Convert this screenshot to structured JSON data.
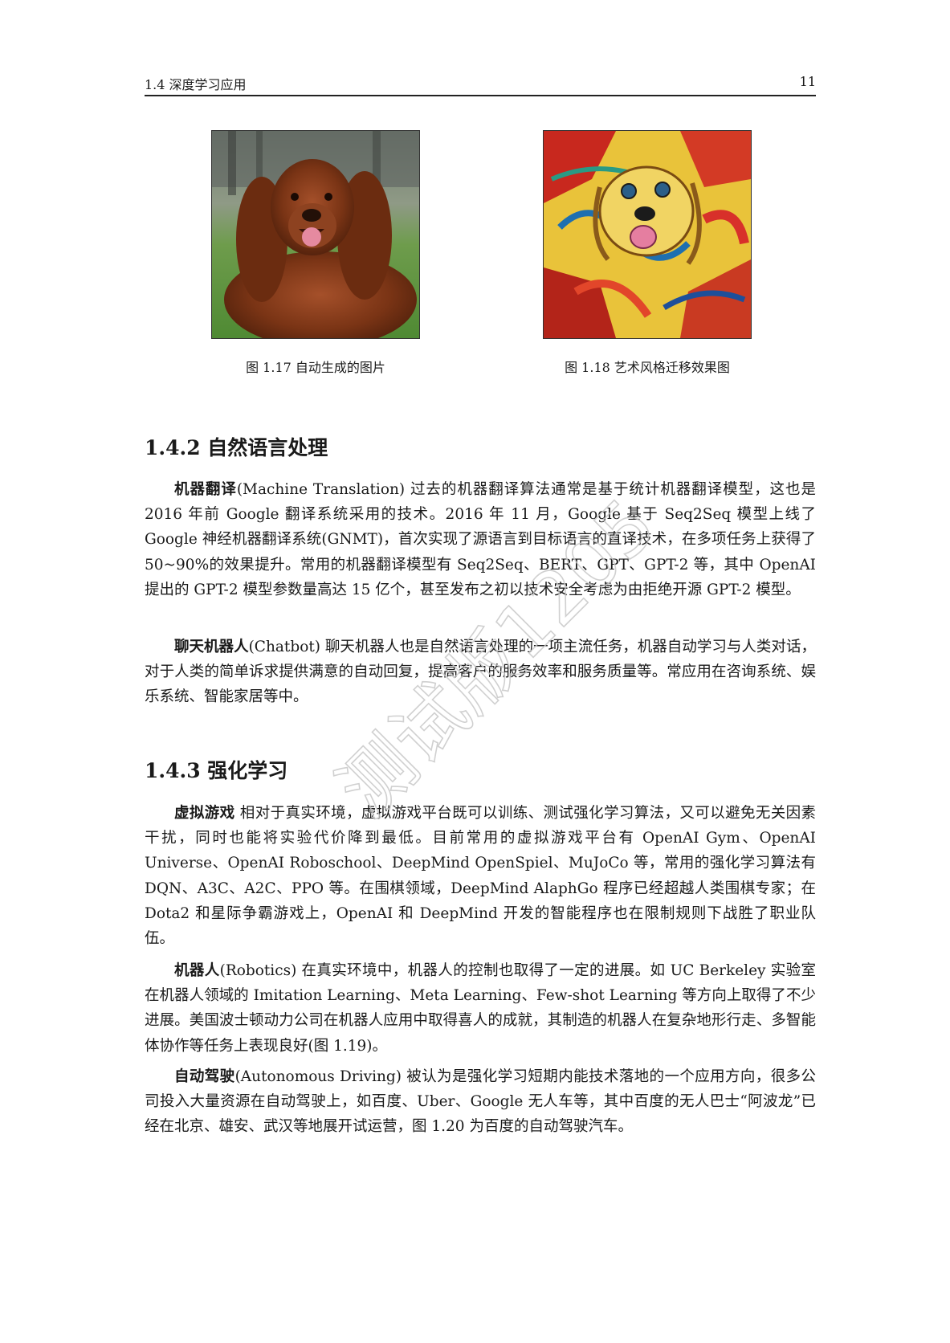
{
  "header": {
    "section": "1.4  深度学习应用",
    "page": "11"
  },
  "figures": [
    {
      "caption": "图 1.17  自动生成的图片"
    },
    {
      "caption": "图 1.18  艺术风格迁移效果图"
    }
  ],
  "sections": [
    {
      "heading": "1.4.2 自然语言处理",
      "paragraphs": [
        {
          "term": "机器翻译",
          "text": "(Machine Translation)  过去的机器翻译算法通常是基于统计机器翻译模型，这也是 2016 年前 Google 翻译系统采用的技术。2016 年 11 月，Google 基于 Seq2Seq 模型上线了 Google 神经机器翻译系统(GNMT)，首次实现了源语言到目标语言的直译技术，在多项任务上获得了 50~90%的效果提升。常用的机器翻译模型有 Seq2Seq、BERT、GPT、GPT-2 等，其中 OpenAI 提出的 GPT-2 模型参数量高达 15 亿个，甚至发布之初以技术安全考虑为由拒绝开源 GPT-2 模型。"
        },
        {
          "term": "聊天机器人",
          "text": "(Chatbot)  聊天机器人也是自然语言处理的一项主流任务，机器自动学习与人类对话，对于人类的简单诉求提供满意的自动回复，提高客户的服务效率和服务质量等。常应用在咨询系统、娱乐系统、智能家居等中。"
        }
      ]
    },
    {
      "heading": "1.4.3 强化学习",
      "paragraphs": [
        {
          "term": "虚拟游戏",
          "text": "  相对于真实环境，虚拟游戏平台既可以训练、测试强化学习算法，又可以避免无关因素干扰，同时也能将实验代价降到最低。目前常用的虚拟游戏平台有 OpenAI Gym、OpenAI Universe、OpenAI Roboschool、DeepMind OpenSpiel、MuJoCo 等，常用的强化学习算法有 DQN、A3C、A2C、PPO 等。在围棋领域，DeepMind AlaphGo 程序已经超越人类围棋专家；在 Dota2 和星际争霸游戏上，OpenAI 和 DeepMind 开发的智能程序也在限制规则下战胜了职业队伍。"
        },
        {
          "term": "机器人",
          "text": "(Robotics)  在真实环境中，机器人的控制也取得了一定的进展。如 UC Berkeley 实验室在机器人领域的 Imitation Learning、Meta Learning、Few-shot Learning 等方向上取得了不少进展。美国波士顿动力公司在机器人应用中取得喜人的成就，其制造的机器人在复杂地形行走、多智能体协作等任务上表现良好(图 1.19)。"
        },
        {
          "term": "自动驾驶",
          "text": "(Autonomous Driving)  被认为是强化学习短期内能技术落地的一个应用方向，很多公司投入大量资源在自动驾驶上，如百度、Uber、Google 无人车等，其中百度的无人巴士“阿波龙”已经在北京、雄安、武汉等地展开试运营，图 1.20 为百度的自动驾驶汽车。"
        }
      ]
    }
  ],
  "watermark": "测试版1205"
}
